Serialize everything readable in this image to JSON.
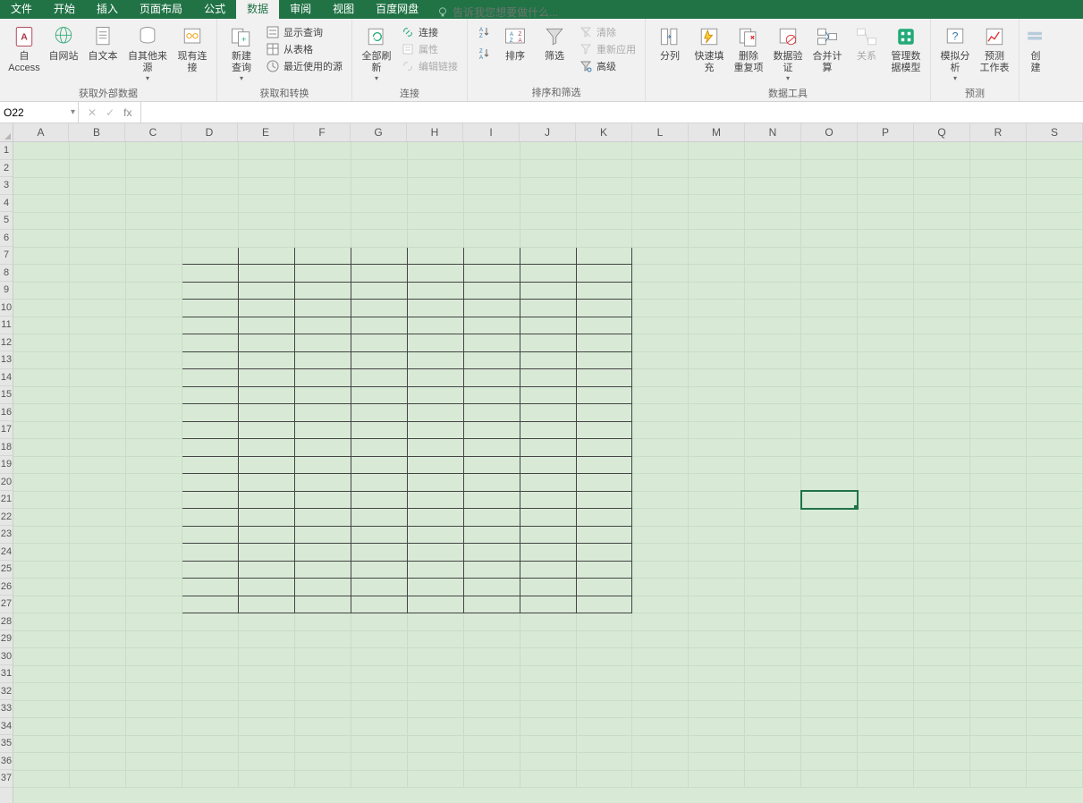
{
  "tabs": [
    "文件",
    "开始",
    "插入",
    "页面布局",
    "公式",
    "数据",
    "审阅",
    "视图",
    "百度网盘"
  ],
  "activeTab": "数据",
  "tellme_placeholder": "告诉我您想要做什么...",
  "ribbon": {
    "group1": {
      "label": "获取外部数据",
      "btns": {
        "access": "自 Access",
        "web": "自网站",
        "text": "自文本",
        "other": "自其他来源",
        "existing": "现有连接"
      }
    },
    "group2": {
      "label": "获取和转换",
      "btns": {
        "newquery": "新建\n查询",
        "showquery": "显示查询",
        "fromtable": "从表格",
        "recent": "最近使用的源"
      }
    },
    "group3": {
      "label": "连接",
      "btns": {
        "refreshall": "全部刷新",
        "connections": "连接",
        "properties": "属性",
        "editlinks": "编辑链接"
      }
    },
    "group4": {
      "label": "排序和筛选",
      "btns": {
        "az": "A↓Z",
        "za": "Z↓A",
        "sort": "排序",
        "filter": "筛选",
        "clear": "清除",
        "reapply": "重新应用",
        "advanced": "高级"
      }
    },
    "group5": {
      "label": "数据工具",
      "btns": {
        "texttocol": "分列",
        "flashfill": "快速填充",
        "removedup": "删除\n重复项",
        "datavalid": "数据验\n证",
        "consolidate": "合并计算",
        "relations": "关系",
        "managemodel": "管理数\n据模型"
      }
    },
    "group6": {
      "label": "预测",
      "btns": {
        "whatif": "模拟分析",
        "forecast": "预测\n工作表"
      }
    },
    "group7": {
      "btns": {
        "create": "创建"
      }
    }
  },
  "namebox_value": "O22",
  "formula_value": "",
  "grid": {
    "columns": [
      "A",
      "B",
      "C",
      "D",
      "E",
      "F",
      "G",
      "H",
      "I",
      "J",
      "K",
      "L",
      "M",
      "N",
      "O",
      "P",
      "Q",
      "R",
      "S"
    ],
    "visibleRows": 37,
    "borderedRegion": {
      "startCol": 3,
      "endCol": 10,
      "startRow": 7,
      "endRow": 27
    },
    "selectedCell": {
      "col": 14,
      "row": 21
    }
  }
}
